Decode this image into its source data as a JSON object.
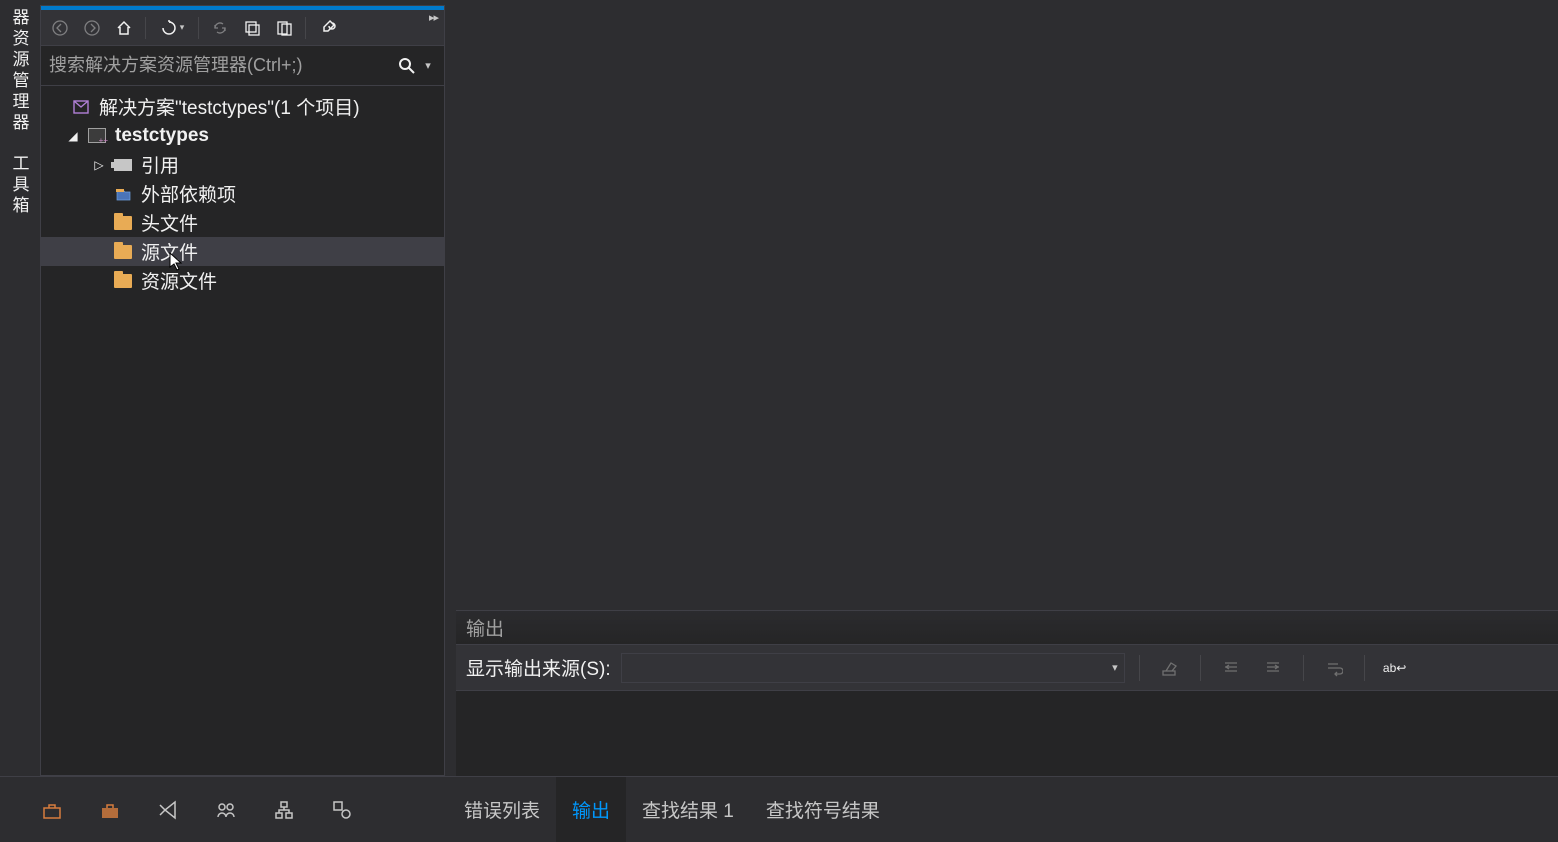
{
  "vertTabs": [
    "器资源管理器",
    "工具箱"
  ],
  "search": {
    "placeholder": "搜索解决方案资源管理器(Ctrl+;)"
  },
  "tree": {
    "solution": "解决方案\"testctypes\"(1 个项目)",
    "project": "testctypes",
    "refs": "引用",
    "external": "外部依赖项",
    "headers": "头文件",
    "sources": "源文件",
    "resources": "资源文件"
  },
  "output": {
    "title": "输出",
    "sourceLabel": "显示输出来源(S):"
  },
  "bottomTabs": {
    "errors": "错误列表",
    "output": "输出",
    "findResults": "查找结果 1",
    "findSymbol": "查找符号结果"
  }
}
